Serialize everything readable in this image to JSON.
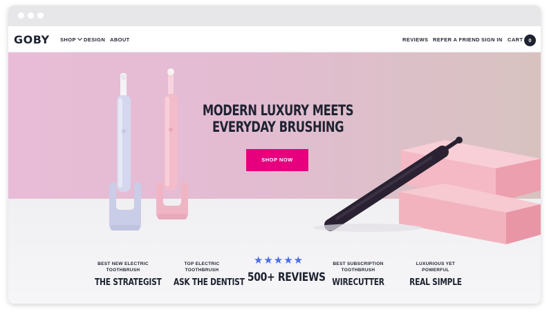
{
  "brand": {
    "logo": "GOBY"
  },
  "nav": {
    "left": [
      {
        "label": "SHOP",
        "has_chevron": true
      },
      {
        "label": "DESIGN"
      },
      {
        "label": "ABOUT"
      }
    ],
    "right": [
      {
        "label": "REVIEWS"
      },
      {
        "label": "REFER A FRIEND"
      },
      {
        "label": "SIGN IN"
      },
      {
        "label": "CART"
      }
    ],
    "cart_count": "0"
  },
  "hero": {
    "headline_line1": "MODERN LUXURY MEETS",
    "headline_line2": "EVERYDAY BRUSHING",
    "cta_label": "SHOP NOW"
  },
  "press": [
    {
      "caption_line1": "BEST NEW ELECTRIC",
      "caption_line2": "TOOTHBRUSH",
      "name": "THE STRATEGIST"
    },
    {
      "caption_line1": "TOP ELECTRIC",
      "caption_line2": "TOOTHBRUSH",
      "name": "ASK THE DENTIST"
    },
    {
      "stars": "★★★★★",
      "name": "500+ REVIEWS"
    },
    {
      "caption_line1": "BEST SUBSCRIPTION",
      "caption_line2": "TOOTHBRUSH",
      "name": "WIRECUTTER"
    },
    {
      "caption_line1": "LUXURIOUS YET",
      "caption_line2": "POWERFUL",
      "name": "REAL SIMPLE"
    }
  ],
  "colors": {
    "accent": "#e6007e",
    "text_dark": "#1e2331",
    "star_blue": "#4a6fe6",
    "hero_pink": "#e8bcd6"
  }
}
